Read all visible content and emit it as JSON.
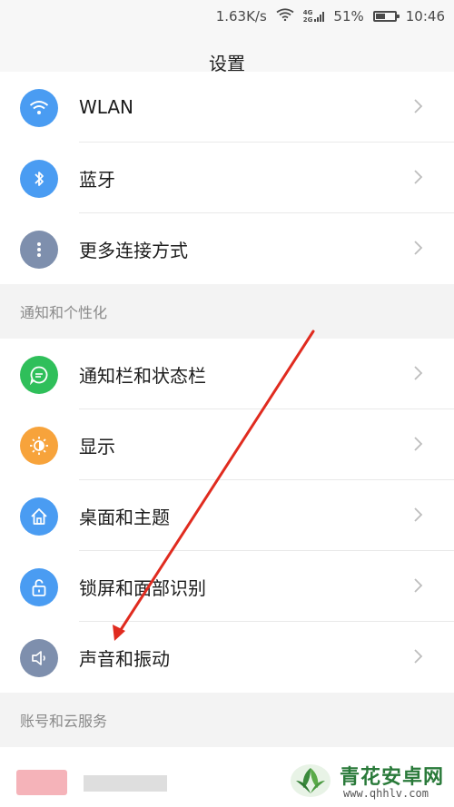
{
  "status_bar": {
    "speed": "1.63K/s",
    "network_4g": "4G",
    "network_2g": "2G",
    "battery_percent_text": "51%",
    "battery_level": 0.51,
    "time": "10:46"
  },
  "header": {
    "title": "设置"
  },
  "connection_items": [
    {
      "label": "WLAN",
      "icon": "wifi-icon",
      "color": "#4a9cf2"
    },
    {
      "label": "蓝牙",
      "icon": "bluetooth-icon",
      "color": "#4a9cf2"
    },
    {
      "label": "更多连接方式",
      "icon": "more-dots-icon",
      "color": "#7e8fad"
    }
  ],
  "sections": {
    "personalization": "通知和个性化",
    "account": "账号和云服务"
  },
  "personalization_items": [
    {
      "label": "通知栏和状态栏",
      "icon": "message-icon",
      "color": "#2fbf5a"
    },
    {
      "label": "显示",
      "icon": "brightness-icon",
      "color": "#f7a33b"
    },
    {
      "label": "桌面和主题",
      "icon": "home-icon",
      "color": "#4a9cf2"
    },
    {
      "label": "锁屏和面部识别",
      "icon": "lock-icon",
      "color": "#4a9cf2"
    },
    {
      "label": "声音和振动",
      "icon": "speaker-icon",
      "color": "#7e8fad"
    }
  ],
  "watermark": {
    "title": "青花安卓网",
    "url": "www.qhhlv.com"
  },
  "colors": {
    "annotation_arrow": "#e02b1f",
    "blue_icon": "#4a9cf2",
    "gray_icon": "#7e8fad",
    "green_icon": "#2fbf5a",
    "orange_icon": "#f7a33b"
  }
}
